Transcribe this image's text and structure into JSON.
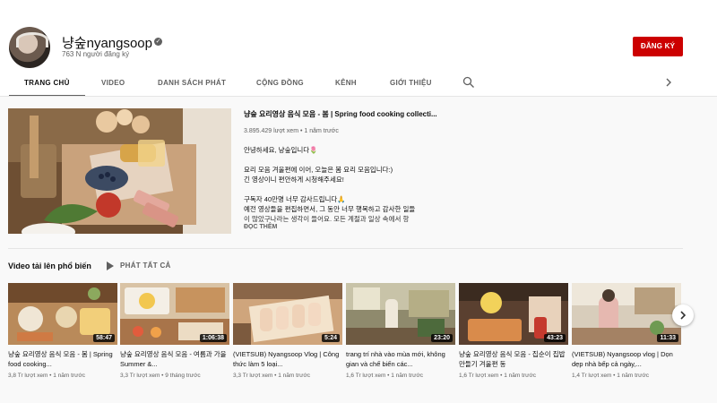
{
  "channel": {
    "name": "냥숲nyangsoop",
    "subscribers": "763 N người đăng ký",
    "subscribe_label": "ĐĂNG KÝ"
  },
  "tabs": [
    {
      "label": "TRANG CHỦ"
    },
    {
      "label": "VIDEO"
    },
    {
      "label": "DANH SÁCH PHÁT"
    },
    {
      "label": "CỘNG ĐỒNG"
    },
    {
      "label": "KÊNH"
    },
    {
      "label": "GIỚI THIỆU"
    }
  ],
  "featured": {
    "title": "냥숲 요리영상 음식 모음 - 봄 | Spring food cooking collecti...",
    "meta": "3.895.429 lượt xem • 1 năm trước",
    "desc": [
      "안녕하세요, 냥숲입니다🌷",
      "요리 모음 겨울편에 이어, 오늘은 봄 요리 모음입니다:)",
      "긴 영상이니 편안하게 시청해주세요!",
      "구독자 40만명 너무 감사드립니다🙏",
      "예전 영상들을 편집하면서, 그 동안 너무 행복하고 감사한 일들",
      "이 많았구나라는 생각이 들어요. 모든 계절과 일상 속에서 항"
    ],
    "read_more": "ĐỌC THÊM"
  },
  "section": {
    "title": "Video tải lên phổ biến",
    "play_all": "PHÁT TẤT CẢ"
  },
  "videos": [
    {
      "title": "냥숲 요리영상 음식 모음 - 봄 | Spring food cooking...",
      "duration": "58:47",
      "meta": "3,8 Tr lượt xem • 1 năm trước"
    },
    {
      "title": "냥숲 요리영상 음식 모음 - 여름과 가을 Summer &...",
      "duration": "1:06:38",
      "meta": "3,3 Tr lượt xem • 9 tháng trước"
    },
    {
      "title": "(VIETSUB) Nyangsoop Vlog | Công thức làm 5 loại...",
      "duration": "5:24",
      "meta": "3,3 Tr lượt xem • 1 năm trước"
    },
    {
      "title": "trang trí nhà vào mùa mới, không gian và chế biến các...",
      "duration": "23:20",
      "meta": "1,6 Tr lượt xem • 1 năm trước"
    },
    {
      "title": "냥숲 요리영상 음식 모음 - 집순이 집밥 만들기 겨울편 동",
      "duration": "43:23",
      "meta": "1,6 Tr lượt xem • 1 năm trước"
    },
    {
      "title": "(VIETSUB) Nyangsoop vlog | Dọn dẹp nhà bếp cả ngày,...",
      "duration": "11:33",
      "meta": "1,4 Tr lượt xem • 1 năm trước"
    }
  ]
}
